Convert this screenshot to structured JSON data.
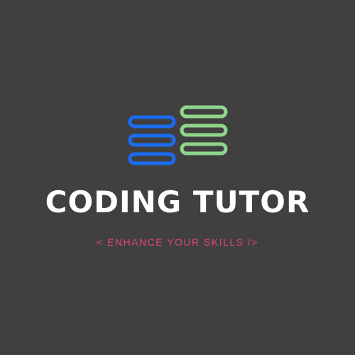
{
  "logo": {
    "icon_name": "stacked-bars-logo-icon",
    "colors": {
      "left_stack": "#1a6cf0",
      "right_stack": "#8fd68c"
    }
  },
  "brand": {
    "name": "CODING TUTOR"
  },
  "tagline": {
    "text": "< ENHANCE YOUR SKILLS />"
  },
  "colors": {
    "background": "#404040",
    "brand_text": "#ffffff",
    "tagline_text": "#e0447a"
  }
}
